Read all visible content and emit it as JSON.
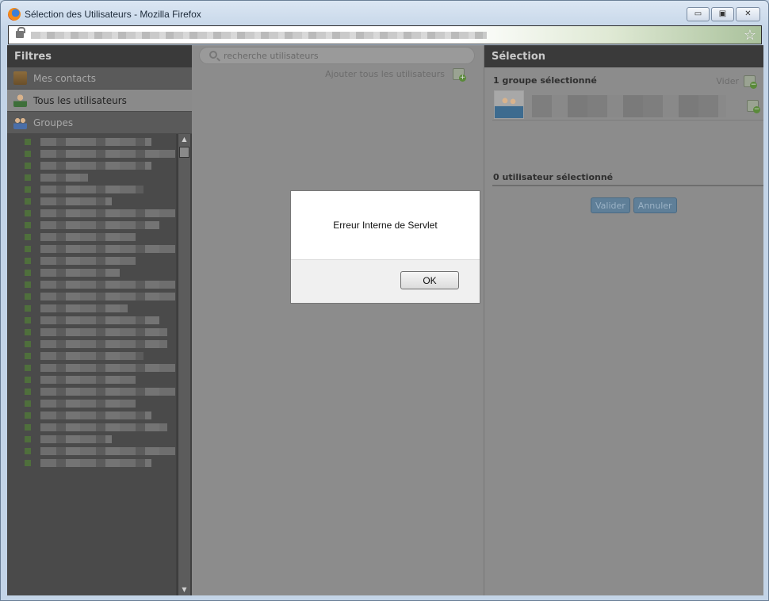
{
  "window": {
    "title": "Sélection des Utilisateurs - Mozilla Firefox",
    "buttons": {
      "minimize": "▭",
      "restore": "▣",
      "close": "✕"
    }
  },
  "filters": {
    "header": "Filtres",
    "items": [
      {
        "label": "Mes contacts",
        "icon": "contacts-book-icon"
      },
      {
        "label": "Tous les utilisateurs",
        "icon": "user-icon"
      },
      {
        "label": "Groupes",
        "icon": "groups-icon"
      }
    ]
  },
  "middle": {
    "search_placeholder": "recherche utilisateurs",
    "add_all_label": "Ajouter tous les utilisateurs"
  },
  "selection": {
    "header": "Sélection",
    "groups_count_label": "1 groupe sélectionné",
    "clear_label": "Vider",
    "users_count_label": "0 utilisateur sélectionné",
    "validate_label": "Valider",
    "cancel_label": "Annuler"
  },
  "dialog": {
    "message": "Erreur Interne de Servlet",
    "ok_label": "OK"
  },
  "colors": {
    "accent_button": "#5f7f98",
    "panel_dark": "#404040",
    "panel_gray": "#8c8c8c"
  }
}
